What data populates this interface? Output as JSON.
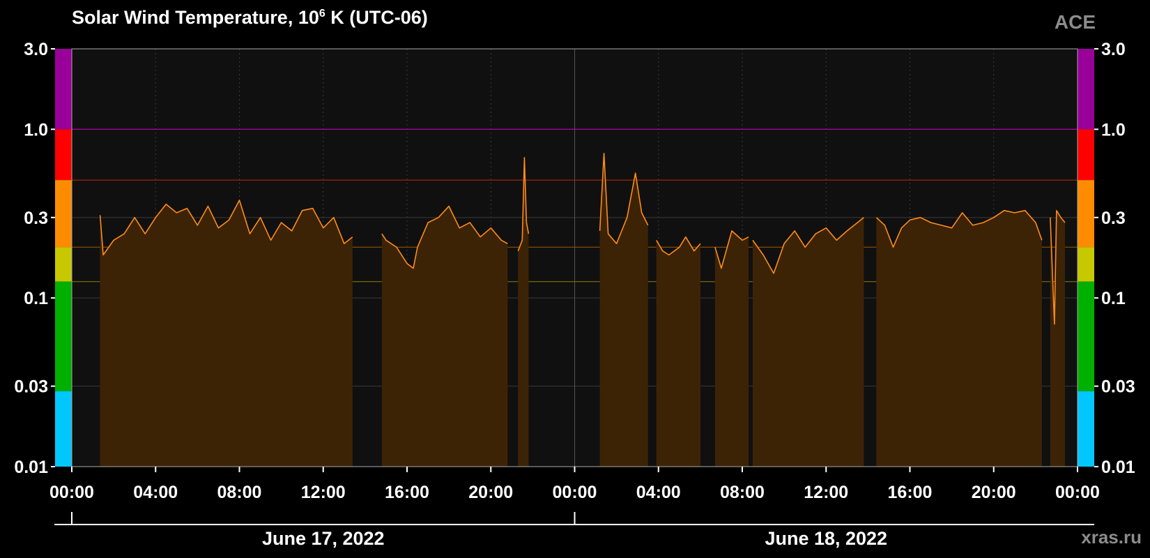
{
  "chart_data": {
    "type": "area",
    "title": "Solar Wind Temperature, 10",
    "title_exp": "6",
    "title_suffix": " K (UTC-06)",
    "source": "ACE",
    "watermark": "xras.ru",
    "yscale": "log",
    "ylim": [
      0.01,
      3.0
    ],
    "y_ticks": [
      0.01,
      0.03,
      0.1,
      0.3,
      1.0,
      3.0
    ],
    "y_tick_labels": [
      "0.01",
      "0.03",
      "0.1",
      "0.3",
      "1.0",
      "3.0"
    ],
    "x_range_hours": [
      0,
      48
    ],
    "x_ticks_hours": [
      0,
      4,
      8,
      12,
      16,
      20,
      24,
      28,
      32,
      36,
      40,
      44,
      48
    ],
    "x_tick_labels": [
      "00:00",
      "04:00",
      "08:00",
      "12:00",
      "16:00",
      "20:00",
      "00:00",
      "04:00",
      "08:00",
      "12:00",
      "16:00",
      "20:00",
      "00:00"
    ],
    "date_labels": [
      {
        "label": "June 17, 2022",
        "center_hour": 12
      },
      {
        "label": "June 18, 2022",
        "center_hour": 36
      }
    ],
    "grid": true,
    "colors": {
      "line": "#ff8c1a",
      "fill": "#3d2305",
      "plot_bg": "#101010",
      "grid": "#3a3a3a"
    },
    "threshold_lines": [
      {
        "value": 1.0,
        "color": "#b000b0"
      },
      {
        "value": 0.5,
        "color": "#b02800"
      },
      {
        "value": 0.2,
        "color": "#8a4a00"
      },
      {
        "value": 0.125,
        "color": "#7a6a00"
      }
    ],
    "color_bands": [
      {
        "from": 1.0,
        "to": 3.0,
        "color": "#990099"
      },
      {
        "from": 0.5,
        "to": 1.0,
        "color": "#ff0000"
      },
      {
        "from": 0.2,
        "to": 0.5,
        "color": "#ff8c00"
      },
      {
        "from": 0.125,
        "to": 0.2,
        "color": "#c8c800"
      },
      {
        "from": 0.028,
        "to": 0.125,
        "color": "#00b000"
      },
      {
        "from": 0.01,
        "to": 0.028,
        "color": "#00c8ff"
      }
    ],
    "series": [
      {
        "segments": [
          {
            "x": [
              1.35,
              1.5,
              2.0,
              2.5,
              3.0,
              3.5,
              4.0,
              4.5,
              5.0,
              5.5,
              6.0,
              6.5,
              7.0,
              7.5,
              8.0,
              8.5,
              9.0,
              9.5,
              10.0,
              10.5,
              11.0,
              11.5,
              12.0,
              12.5,
              13.0,
              13.4
            ],
            "y": [
              0.31,
              0.18,
              0.22,
              0.24,
              0.3,
              0.24,
              0.3,
              0.36,
              0.32,
              0.34,
              0.27,
              0.35,
              0.26,
              0.29,
              0.38,
              0.24,
              0.3,
              0.22,
              0.28,
              0.25,
              0.33,
              0.34,
              0.26,
              0.3,
              0.21,
              0.23
            ]
          },
          {
            "x": [
              14.8,
              15.0,
              15.5,
              16.0,
              16.3,
              16.5,
              17.0,
              17.5,
              18.0,
              18.5,
              19.0,
              19.5,
              20.0,
              20.5,
              20.8
            ],
            "y": [
              0.24,
              0.22,
              0.2,
              0.16,
              0.15,
              0.2,
              0.28,
              0.3,
              0.35,
              0.26,
              0.28,
              0.23,
              0.26,
              0.22,
              0.21
            ]
          },
          {
            "x": [
              21.3,
              21.5,
              21.6,
              21.7,
              21.8
            ],
            "y": [
              0.19,
              0.22,
              0.68,
              0.28,
              0.24
            ]
          },
          {
            "x": [
              25.2,
              25.4,
              25.6,
              26.0,
              26.5,
              26.9,
              27.2,
              27.5
            ],
            "y": [
              0.25,
              0.72,
              0.24,
              0.21,
              0.3,
              0.55,
              0.32,
              0.27
            ]
          },
          {
            "x": [
              27.9,
              28.2,
              28.5,
              29.0,
              29.3,
              29.7,
              30.0
            ],
            "y": [
              0.22,
              0.19,
              0.18,
              0.2,
              0.23,
              0.19,
              0.21
            ]
          },
          {
            "x": [
              30.7,
              31.0,
              31.5,
              32.0,
              32.3
            ],
            "y": [
              0.2,
              0.15,
              0.25,
              0.22,
              0.23
            ]
          },
          {
            "x": [
              32.5,
              33.0,
              33.5,
              34.0,
              34.5,
              35.0,
              35.5,
              36.0,
              36.5,
              37.0,
              37.5,
              37.8
            ],
            "y": [
              0.22,
              0.18,
              0.14,
              0.21,
              0.25,
              0.2,
              0.24,
              0.26,
              0.22,
              0.25,
              0.28,
              0.3
            ]
          },
          {
            "x": [
              38.4,
              38.8,
              39.2,
              39.6,
              40.0,
              40.5,
              41.0,
              41.5,
              42.0,
              42.5,
              43.0,
              43.5,
              44.0,
              44.5,
              45.0,
              45.5,
              46.0,
              46.3
            ],
            "y": [
              0.3,
              0.27,
              0.2,
              0.26,
              0.29,
              0.3,
              0.28,
              0.27,
              0.26,
              0.32,
              0.27,
              0.28,
              0.3,
              0.33,
              0.32,
              0.33,
              0.28,
              0.22
            ]
          },
          {
            "x": [
              46.7,
              46.9,
              47.0,
              47.2,
              47.4
            ],
            "y": [
              0.3,
              0.07,
              0.33,
              0.3,
              0.28
            ]
          }
        ]
      }
    ]
  }
}
